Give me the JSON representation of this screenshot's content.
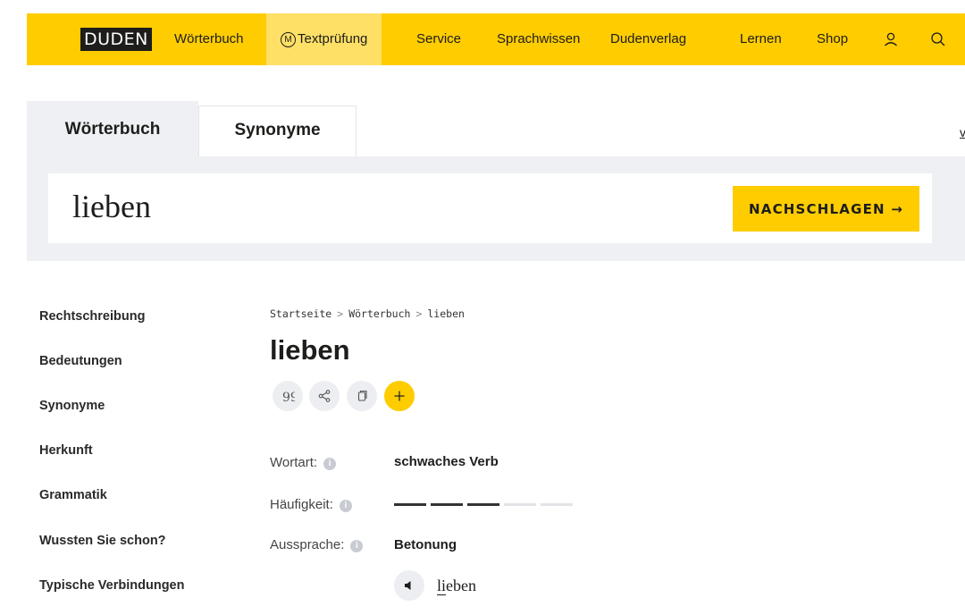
{
  "nav": {
    "logo": "DUDEN",
    "items": [
      {
        "label": "Wörterbuch"
      },
      {
        "label": "Textprüfung",
        "badge": "M"
      },
      {
        "label": "Service"
      },
      {
        "label": "Sprachwissen"
      },
      {
        "label": "Dudenverlag"
      },
      {
        "label": "Lernen"
      },
      {
        "label": "Shop"
      }
    ],
    "icons": [
      "user-icon",
      "search-icon"
    ]
  },
  "search": {
    "tabs": [
      {
        "label": "Wörterbuch"
      },
      {
        "label": "Synonyme"
      }
    ],
    "active_tab": "Wörterbuch",
    "query": "lieben",
    "button_label": "NACHSCHLAGEN →"
  },
  "edge_letter": "v",
  "sidebar": {
    "items": [
      {
        "label": "Rechtschreibung"
      },
      {
        "label": "Bedeutungen"
      },
      {
        "label": "Synonyme"
      },
      {
        "label": "Herkunft"
      },
      {
        "label": "Grammatik"
      },
      {
        "label": "Wussten Sie schon?"
      },
      {
        "label": "Typische Verbindungen"
      }
    ]
  },
  "breadcrumb": [
    "Startseite",
    "Wörterbuch",
    "lieben"
  ],
  "breadcrumb_separator": ">",
  "entry": {
    "title": "lieben",
    "actions": [
      "quote-icon",
      "share-icon",
      "copy-icon",
      "plus-icon"
    ],
    "wortart": {
      "label": "Wortart:",
      "value": "schwaches Verb"
    },
    "haeufigkeit": {
      "label": "Häufigkeit:",
      "level": 3,
      "max": 5
    },
    "aussprache": {
      "label": "Aussprache:",
      "betonung": "Betonung",
      "word_stressed": "li",
      "word_rest": "eben"
    },
    "info_glyph": "i"
  },
  "colors": {
    "brand_yellow": "#ffcc00",
    "active_nav_bg": "#ffe066",
    "panel_gray": "#eef0f3",
    "freq_filled": "#333333",
    "freq_empty": "#e2e4e8"
  }
}
